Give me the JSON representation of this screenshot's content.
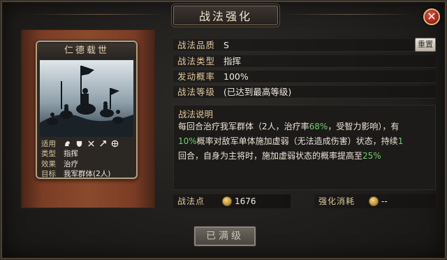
{
  "window": {
    "title": "战法强化",
    "close_glyph": "✕"
  },
  "card": {
    "name": "仁德载世",
    "info": [
      {
        "key": "适用",
        "value": ""
      },
      {
        "key": "类型",
        "value": "指挥"
      },
      {
        "key": "效果",
        "value": "治疗"
      },
      {
        "key": "目标",
        "value": "我军群体(2人)"
      }
    ],
    "adapt_icons": [
      "cavalry-icon",
      "shield-icon",
      "crossed-swords-icon",
      "bow-icon",
      "wheel-icon"
    ]
  },
  "fields": [
    {
      "label": "战法品质",
      "value": "S"
    },
    {
      "label": "战法类型",
      "value": "指挥"
    },
    {
      "label": "发动概率",
      "value": "100%"
    },
    {
      "label": "战法等级",
      "value": "(已达到最高等级)"
    }
  ],
  "reset_label": "重置",
  "description": {
    "heading": "战法说明",
    "line1_a": "每回合治疗我军群体（2人，治疗率",
    "line1_hl": "68%",
    "line1_b": "，受智力影响），有",
    "line2_hl": "10%",
    "line2_a": "概率对敌军单体施加虚弱（无法造成伤害）状态，持续",
    "line2_hl2": "1",
    "line3_a": "回合，自身为主将时，施加虚弱状态的概率提高至",
    "line3_hl": "25%"
  },
  "points": {
    "label": "战法点",
    "value": "1676"
  },
  "cost": {
    "label": "强化消耗",
    "value": "--"
  },
  "maxed_button": "已满级",
  "colors": {
    "highlight": "#6fcf6a",
    "accent": "#e0c79a",
    "close": "#c0392b"
  }
}
